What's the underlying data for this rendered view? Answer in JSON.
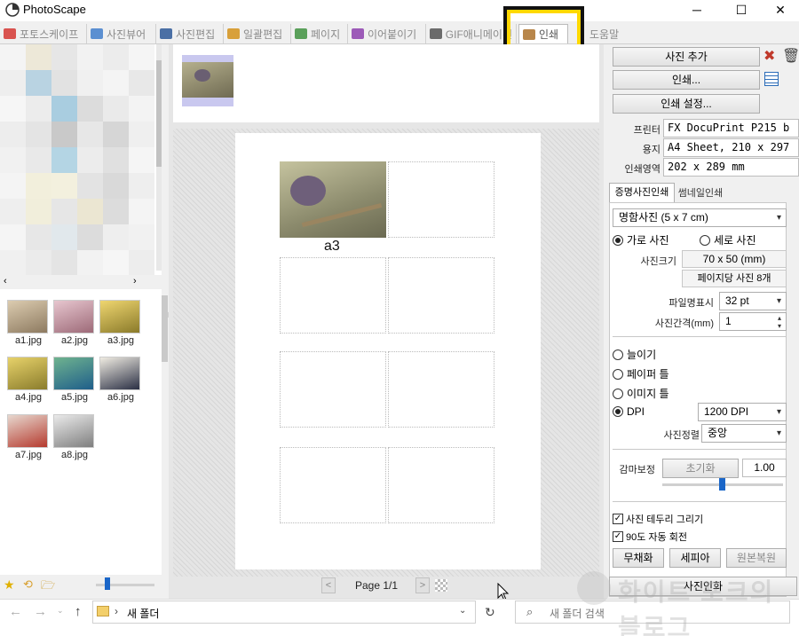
{
  "window": {
    "title": "PhotoScape",
    "minimize": "─",
    "maximize": "☐",
    "close": "✕"
  },
  "tabs": [
    {
      "label": "포토스케이프",
      "color": "#d9534f"
    },
    {
      "label": "사진뷰어",
      "color": "#5b8fd1"
    },
    {
      "label": "사진편집",
      "color": "#4a6fa5"
    },
    {
      "label": "일괄편집",
      "color": "#d8a03a"
    },
    {
      "label": "페이지",
      "color": "#5aa05a"
    },
    {
      "label": "이어붙이기",
      "color": "#9c5ab8"
    },
    {
      "label": "GIF애니메이션",
      "color": "#6b6b6b"
    },
    {
      "label": "인쇄",
      "color": "#b8864a",
      "active": true
    },
    {
      "label": "도움말",
      "color": "#999999"
    }
  ],
  "overlay_caption": "인쇄",
  "thumbnails": [
    {
      "label": "a1.jpg",
      "color": "#b9a58a"
    },
    {
      "label": "a2.jpg",
      "color": "#c99fa6"
    },
    {
      "label": "a3.jpg",
      "color": "#d7b84a"
    },
    {
      "label": "a4.jpg",
      "color": "#c8b545"
    },
    {
      "label": "a5.jpg",
      "color": "#3e8a6a"
    },
    {
      "label": "a6.jpg",
      "color": "#d9d2c4"
    },
    {
      "label": "a7.jpg",
      "color": "#b85a4a"
    },
    {
      "label": "a8.jpg",
      "color": "#b9b9b9"
    }
  ],
  "preview": {
    "photo_caption": "a3",
    "page_label": "Page 1/1",
    "prev": "<",
    "next": ">"
  },
  "right": {
    "add_photo": "사진 추가",
    "print": "인쇄...",
    "print_settings": "인쇄 설정...",
    "printer_label": "프린터",
    "printer_value": "FX DocuPrint P215 b",
    "paper_label": "용지",
    "paper_value": "A4 Sheet, 210 x 297 mm",
    "area_label": "인쇄영역",
    "area_value": "202 x 289 mm",
    "subtab_active": "증명사진인쇄",
    "subtab_other": "썸네일인쇄",
    "size_select": "명함사진 (5 x 7 cm)",
    "orient_landscape": "가로 사진",
    "orient_portrait": "세로 사진",
    "photo_size_label": "사진크기",
    "photo_size_value": "70 x 50 (mm)",
    "per_page_value": "페이지당 사진 8개",
    "filename_label": "파일명표시",
    "filename_value": "32 pt",
    "spacing_label": "사진간격(mm)",
    "spacing_value": "1",
    "fit_stretch": "늘이기",
    "fit_paper": "페이퍼 틀",
    "fit_image": "이미지 틀",
    "fit_dpi": "DPI",
    "dpi_value": "1200 DPI",
    "align_label": "사진정렬",
    "align_value": "중앙",
    "gamma_label": "감마보정",
    "gamma_reset": "초기화",
    "gamma_value": "1.00",
    "gamma_level": 0.5,
    "draw_border": "사진 테두리 그리기",
    "auto_rotate": "90도 자동 회전",
    "mono": "무채화",
    "sepia": "세피아",
    "restore": "원본복원",
    "save_photo": "사진인화"
  },
  "explorer": {
    "folder": "새 폴더",
    "search_placeholder": "새 폴더 검색"
  },
  "watermark": "화이트 포크의 블로그"
}
